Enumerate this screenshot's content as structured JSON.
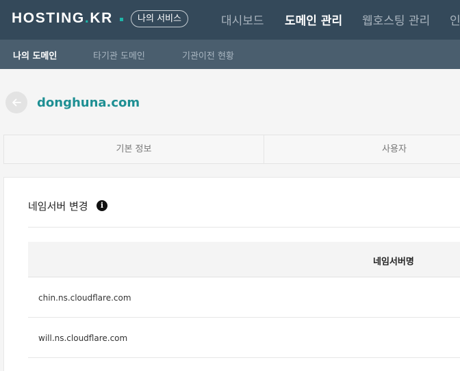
{
  "header": {
    "logo_text": "HOSTING",
    "logo_dot": ".",
    "logo_suffix": "KR",
    "my_services": "나의 서비스",
    "nav": [
      "대시보드",
      "도메인 관리",
      "웹호스팅 관리",
      "인"
    ],
    "active_nav": "도메인 관리"
  },
  "subnav": {
    "items": [
      "나의 도메인",
      "타기관 도메인",
      "기관이전 현황"
    ],
    "active": "나의 도메인"
  },
  "domain": {
    "name": "donghuna.com"
  },
  "tabs": [
    "기본 정보",
    "사용자"
  ],
  "nameserver": {
    "title": "네임서버 변경",
    "info_icon": "i",
    "column_header": "네임서버명",
    "rows": [
      "chin.ns.cloudflare.com",
      "will.ns.cloudflare.com"
    ]
  },
  "colors": {
    "topbar": "#34495a",
    "subbar": "#4a5e6e",
    "accent": "#1e8f93",
    "logo_dot": "#1fb5a8"
  },
  "icons": {
    "back": "arrow-left-icon",
    "info": "info-icon"
  }
}
